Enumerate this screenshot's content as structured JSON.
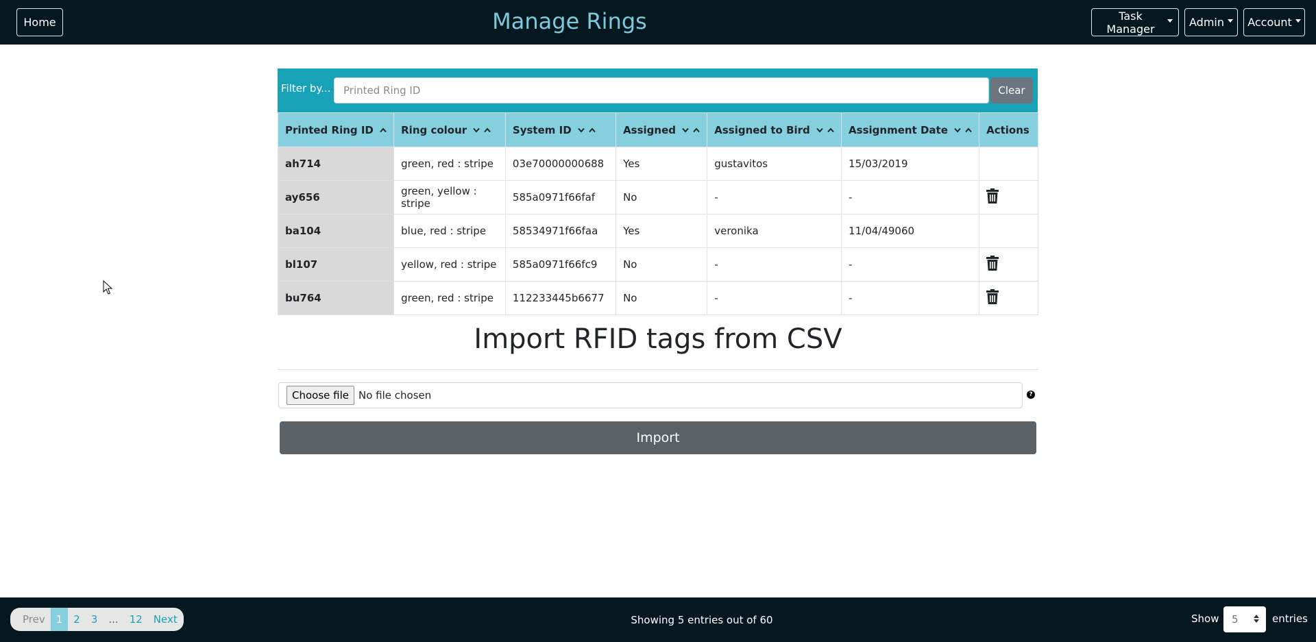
{
  "nav": {
    "home_label": "Home",
    "title": "Manage Rings",
    "task_manager_label": "Task Manager",
    "admin_label": "Admin",
    "account_label": "Account"
  },
  "filter": {
    "label": "Filter by...",
    "placeholder": "Printed Ring ID",
    "clear_label": "Clear"
  },
  "table": {
    "headers": {
      "printed_ring_id": "Printed Ring ID",
      "ring_colour": "Ring colour",
      "system_id": "System ID",
      "assigned": "Assigned",
      "assigned_to_bird": "Assigned to Bird",
      "assignment_date": "Assignment Date",
      "actions": "Actions"
    },
    "rows": [
      {
        "ring_id": "ah714",
        "colour": "green, red : stripe",
        "system_id": "03e70000000688",
        "assigned": "Yes",
        "bird": "gustavitos",
        "date": "15/03/2019",
        "deletable": false
      },
      {
        "ring_id": "ay656",
        "colour": "green, yellow : stripe",
        "system_id": "585a0971f66faf",
        "assigned": "No",
        "bird": "-",
        "date": "-",
        "deletable": true
      },
      {
        "ring_id": "ba104",
        "colour": "blue, red : stripe",
        "system_id": "58534971f66faa",
        "assigned": "Yes",
        "bird": "veronika",
        "date": "11/04/49060",
        "deletable": false
      },
      {
        "ring_id": "bl107",
        "colour": "yellow, red : stripe",
        "system_id": "585a0971f66fc9",
        "assigned": "No",
        "bird": "-",
        "date": "-",
        "deletable": true
      },
      {
        "ring_id": "bu764",
        "colour": "green, red : stripe",
        "system_id": "112233445b6677",
        "assigned": "No",
        "bird": "-",
        "date": "-",
        "deletable": true
      }
    ]
  },
  "import": {
    "title": "Import RFID tags from CSV",
    "choose_file_label": "Choose file",
    "file_status": "No file chosen",
    "help_icon": "?",
    "import_label": "Import"
  },
  "footer": {
    "pagination": {
      "prev": "Prev",
      "pages": [
        "1",
        "2",
        "3"
      ],
      "ellipsis": "...",
      "last_page": "12",
      "next": "Next",
      "active_page": "1"
    },
    "status": "Showing 5 entries out of 60",
    "show_label": "Show",
    "entries_value": "5",
    "entries_label": "entries"
  },
  "colors": {
    "navbar_bg": "#051820",
    "title_color": "#7dc9dd",
    "filter_bg": "#17a2b8",
    "header_bg": "#86cfdf",
    "first_col_bg": "#d9d9d9",
    "import_btn_bg": "#5a6268"
  }
}
